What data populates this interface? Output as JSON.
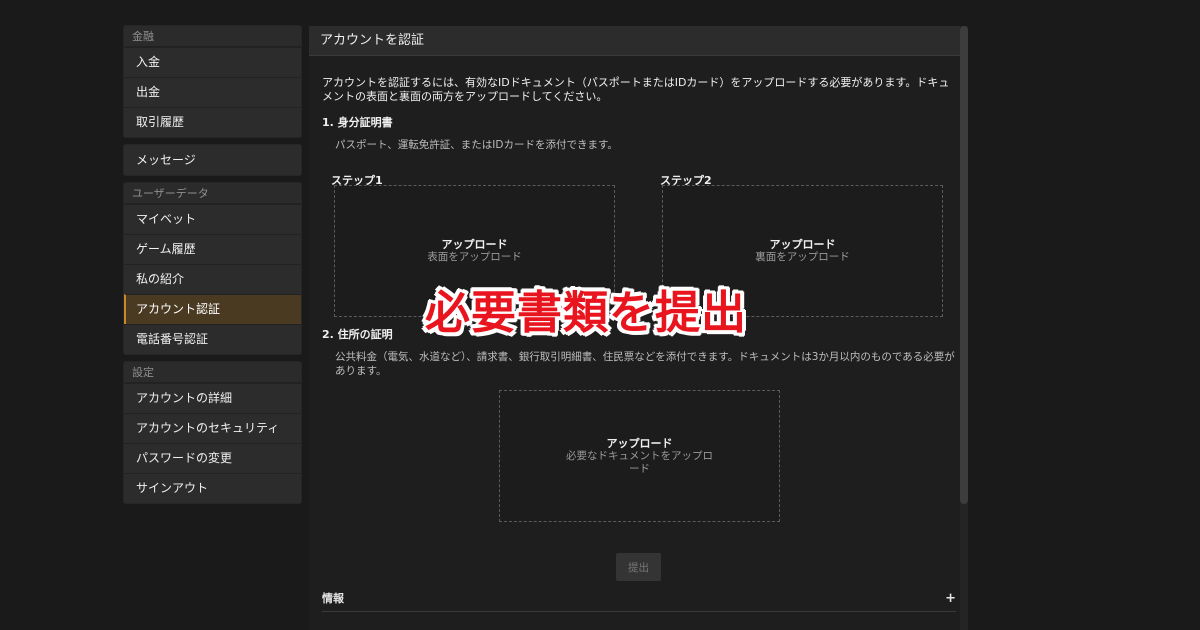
{
  "sidebar": {
    "finance": {
      "label": "金融",
      "items": [
        "入金",
        "出金",
        "取引履歴"
      ]
    },
    "messages": {
      "label": "メッセージ"
    },
    "user_data": {
      "label": "ユーザーデータ",
      "items": [
        "マイベット",
        "ゲーム履歴",
        "私の紹介",
        "アカウント認証",
        "電話番号認証"
      ],
      "active": "アカウント認証"
    },
    "settings": {
      "label": "設定",
      "items": [
        "アカウントの詳細",
        "アカウントのセキュリティ",
        "パスワードの変更",
        "サインアウト"
      ]
    }
  },
  "main": {
    "title": "アカウントを認証",
    "intro": "アカウントを認証するには、有効なIDドキュメント（パスポートまたはIDカード）をアップロードする必要があります。ドキュメントの表面と裏面の両方をアップロードしてください。",
    "section1": {
      "title": "1. 身分証明書",
      "desc": "パスポート、運転免許証、またはIDカードを添付できます。",
      "step1": {
        "label": "ステップ1",
        "title": "アップロード",
        "sub": "表面をアップロード"
      },
      "step2": {
        "label": "ステップ2",
        "title": "アップロード",
        "sub": "裏面をアップロード"
      }
    },
    "section2": {
      "title": "2. 住所の証明",
      "desc": "公共料金（電気、水道など）、請求書、銀行取引明細書、住民票などを添付できます。ドキュメントは3か月以内のものである必要があります。",
      "upload": {
        "title": "アップロード",
        "sub": "必要なドキュメントをアップロード"
      }
    },
    "submit_label": "提出",
    "info_label": "情報",
    "info_toggle": "+"
  },
  "overlay_text": "必要書類を提出",
  "colors": {
    "background": "#1a1a1a",
    "panel": "#2c2c2c",
    "active_accent": "#c8882a",
    "overlay_text": "#e8141e"
  }
}
